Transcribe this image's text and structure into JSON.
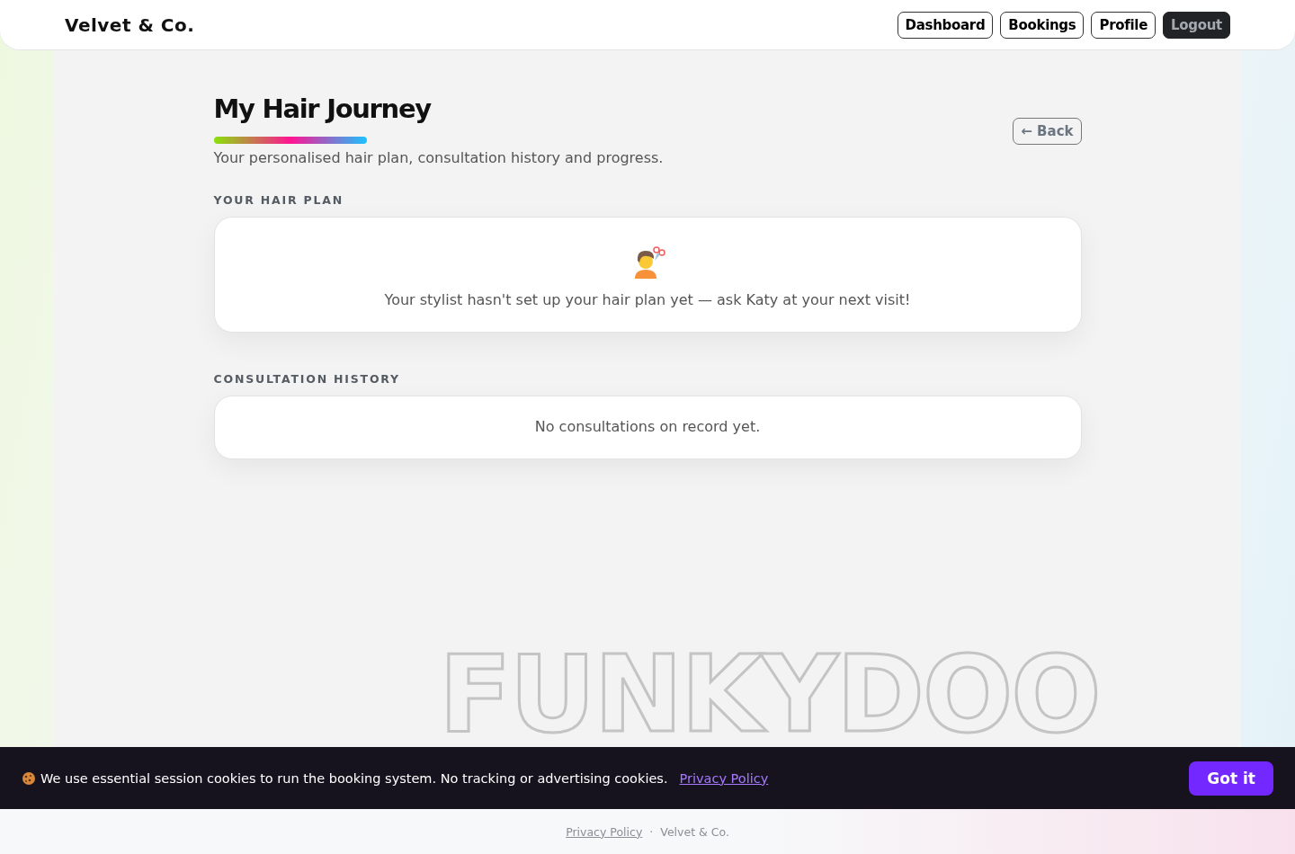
{
  "header": {
    "brand": "Velvet & Co.",
    "nav": [
      {
        "label": "Dashboard",
        "kind": "outline"
      },
      {
        "label": "Bookings",
        "kind": "outline"
      },
      {
        "label": "Profile",
        "kind": "outline"
      },
      {
        "label": "Logout",
        "kind": "dark"
      }
    ]
  },
  "page": {
    "title": "My Hair Journey",
    "subtitle": "Your personalised hair plan, consultation history and progress.",
    "back_button": "← Back"
  },
  "sections": [
    {
      "heading": "YOUR HAIR PLAN",
      "kind": "icon",
      "message": "Your stylist hasn't set up your hair plan yet — ask Katy at your next visit!"
    },
    {
      "heading": "CONSULTATION HISTORY",
      "kind": "plain",
      "message": "No consultations on record yet."
    }
  ],
  "decorative_text": "FUNKYDOO",
  "cookie_banner": {
    "message": "We use essential session cookies to run the booking system. No tracking or advertising cookies.",
    "link": "Privacy Policy",
    "button": "Got it"
  },
  "footer": {
    "link": "Privacy Policy",
    "separator": "·",
    "brand": "Velvet & Co."
  }
}
